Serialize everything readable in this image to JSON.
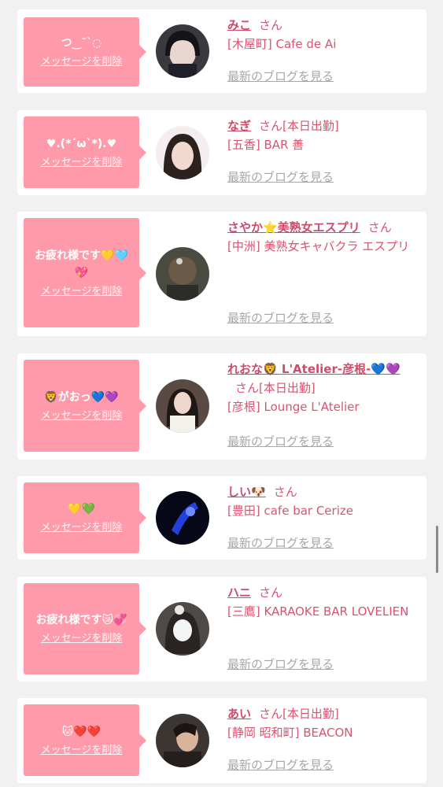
{
  "delete_label": "メッセージを削除",
  "blog_label": "最新のブログを見る",
  "san_label": "さん",
  "colors": {
    "bubble": "#fe9aa9",
    "name": "#d04a6a",
    "text": "#d85470",
    "link_gray": "#a7a7a7"
  },
  "items": [
    {
      "message": "つ‿˘`◌",
      "name": "みこ",
      "san_suffix": "",
      "shop": "[木屋町] Cafe de Ai",
      "avatar_icon": "girl-photo-avatar"
    },
    {
      "message": "♥.(*´ω`*).♥",
      "name": "なぎ",
      "san_suffix": "[本日出勤]",
      "shop": "[五香] BAR 善",
      "avatar_icon": "girl-photo-avatar"
    },
    {
      "message": "お疲れ様です💛🩵💖",
      "name": "さやか⭐美熟女エスプリ",
      "san_suffix": "",
      "shop": "[中洲] 美熟女キャバクラ エスプリ",
      "avatar_icon": "hair-photo-avatar"
    },
    {
      "message": "🦁がおっ💙💜",
      "name": "れおな🦁 L'Atelier-彦根-💙💜",
      "san_suffix": "[本日出勤]",
      "shop": "[彦根] Lounge L'Atelier",
      "avatar_icon": "girl-photo-avatar"
    },
    {
      "message": "💛💚",
      "name": "しい🐶",
      "san_suffix": "",
      "shop": "[豊田] cafe bar Cerize",
      "avatar_icon": "blue-light-avatar"
    },
    {
      "message": "お疲れ様です😿💞",
      "name": "ハニ",
      "san_suffix": "",
      "shop": "[三鷹] KARAOKE BAR LOVELIEN",
      "avatar_icon": "girl-photo-avatar"
    },
    {
      "message": "🐱❤️❤️",
      "name": "あい",
      "san_suffix": "[本日出勤]",
      "shop": "[静岡 昭和町] BEACON",
      "avatar_icon": "girl-photo-avatar"
    }
  ]
}
